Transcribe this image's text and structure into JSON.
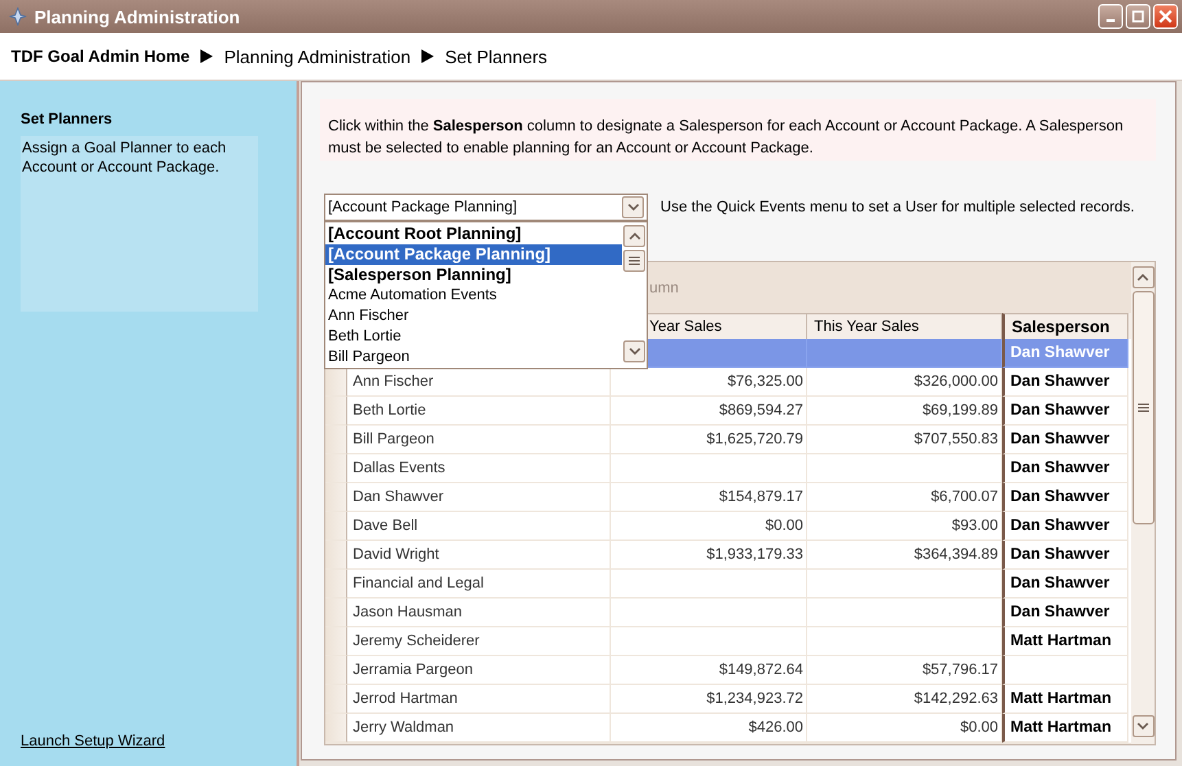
{
  "window": {
    "title": "Planning Administration"
  },
  "breadcrumb": [
    {
      "label": "TDF Goal Admin Home",
      "current": false
    },
    {
      "label": "Planning Administration",
      "current": true
    },
    {
      "label": "Set Planners",
      "current": true
    }
  ],
  "sidebar": {
    "title": "Set Planners",
    "description": "Assign a Goal Planner to each Account or Account Package.",
    "link": "Launch Setup Wizard"
  },
  "info": "Click within the **Salesperson** column to designate a Salesperson for each Account or Account Package.  A Salesperson must be selected to enable planning for an Account or Account Package.",
  "combo": {
    "value": "[Account Package Planning]",
    "hint": "Use the Quick Events menu to set a User for multiple selected records.",
    "options": [
      {
        "label": "[Account Root Planning]",
        "kind": "group",
        "selected": false
      },
      {
        "label": "[Account Package Planning]",
        "kind": "group",
        "selected": true
      },
      {
        "label": "[Salesperson Planning]",
        "kind": "group",
        "selected": false
      },
      {
        "label": "Acme Automation Events",
        "kind": "user",
        "selected": false
      },
      {
        "label": "Ann Fischer",
        "kind": "user",
        "selected": false
      },
      {
        "label": "Beth Lortie",
        "kind": "user",
        "selected": false
      },
      {
        "label": "Bill Pargeon",
        "kind": "user",
        "selected": false
      }
    ]
  },
  "grid": {
    "group_band": "umn",
    "columns": [
      "Year Sales",
      "This Year Sales",
      "Salesperson"
    ],
    "rows": [
      {
        "last": "",
        "this": "",
        "salesperson": "Dan Shawver",
        "selected": true
      },
      {
        "name": "Ann Fischer",
        "last": "$76,325.00",
        "this": "$326,000.00",
        "salesperson": "Dan Shawver",
        "selected": false
      },
      {
        "name": "Beth Lortie",
        "last": "$869,594.27",
        "this": "$69,199.89",
        "salesperson": "Dan Shawver",
        "selected": false
      },
      {
        "name": "Bill Pargeon",
        "last": "$1,625,720.79",
        "this": "$707,550.83",
        "salesperson": "Dan Shawver",
        "selected": false
      },
      {
        "name": "Dallas Events",
        "salesperson": "Dan Shawver",
        "selected": false
      },
      {
        "name": "Dan Shawver",
        "last": "$154,879.17",
        "this": "$6,700.07",
        "salesperson": "Dan Shawver",
        "selected": false
      },
      {
        "name": "Dave Bell",
        "last": "$0.00",
        "this": "$93.00",
        "salesperson": "Dan Shawver",
        "selected": false
      },
      {
        "name": "David Wright",
        "last": "$1,933,179.33",
        "this": "$364,394.89",
        "salesperson": "Dan Shawver",
        "selected": false
      },
      {
        "name": "Financial and Legal",
        "salesperson": "Dan Shawver",
        "selected": false
      },
      {
        "name": "Jason Hausman",
        "salesperson": "Dan Shawver",
        "selected": false
      },
      {
        "name": "Jeremy Scheiderer",
        "salesperson": "Matt Hartman",
        "selected": false
      },
      {
        "name": "Jerramia Pargeon",
        "last": "$149,872.64",
        "this": "$57,796.17",
        "selected": false
      },
      {
        "name": "Jerrod Hartman",
        "last": "$1,234,923.72",
        "this": "$142,292.63",
        "salesperson": "Matt Hartman",
        "selected": false
      },
      {
        "name": "Jerry Waldman",
        "last": "$426.00",
        "this": "$0.00",
        "salesperson": "Matt Hartman",
        "selected": false
      }
    ]
  }
}
